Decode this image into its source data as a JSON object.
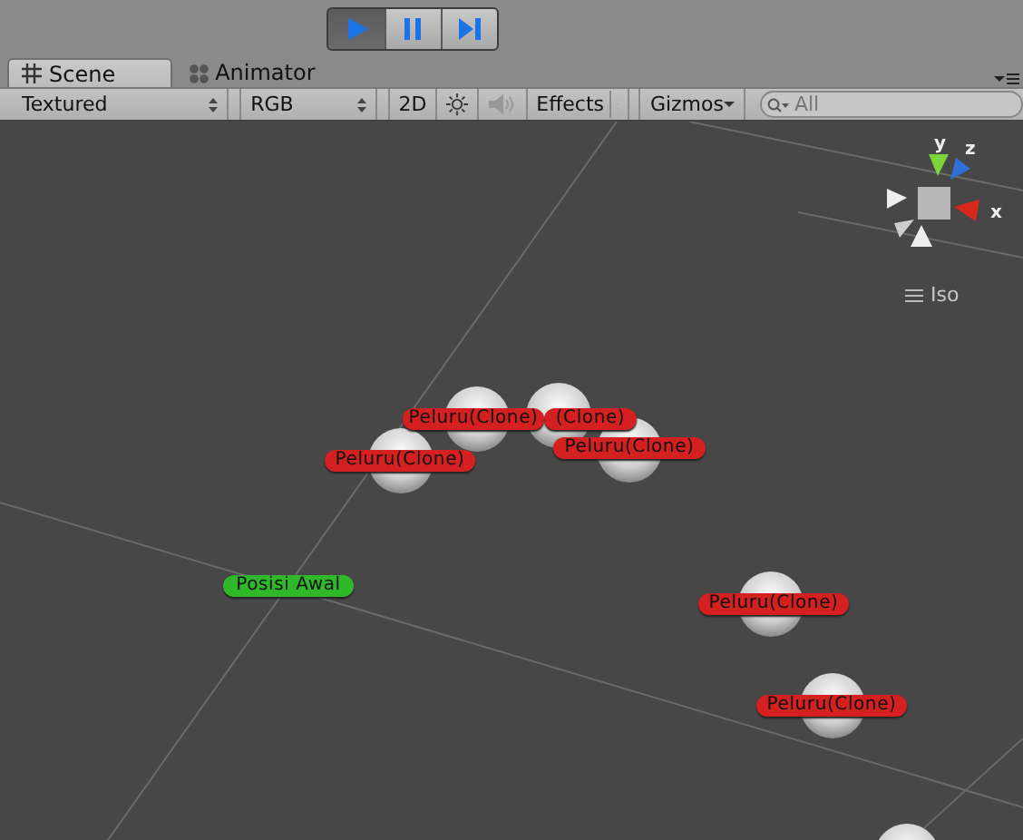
{
  "play_controls": [
    {
      "kind": "play",
      "selected": true
    },
    {
      "kind": "pause",
      "selected": false
    },
    {
      "kind": "step",
      "selected": false
    }
  ],
  "tabs": [
    {
      "label": "Scene",
      "kind": "scene",
      "selected": true
    },
    {
      "label": "Animator",
      "kind": "animator",
      "selected": false
    }
  ],
  "scene_toolbar": {
    "render_mode": "Textured",
    "color_mode": "RGB",
    "mode_2d": "2D",
    "audio": {
      "disabled": true
    },
    "effects": "Effects",
    "gizmos": "Gizmos",
    "search": {
      "placeholder": "All"
    }
  },
  "orientation_gizmo": {
    "axes": [
      "y",
      "z",
      "x"
    ],
    "projection": "Iso"
  },
  "labels": [
    {
      "text": "Peluru(Clone)",
      "color": "#d42020"
    },
    {
      "text": "(Clone)",
      "color": "#d42020"
    },
    {
      "text": "Peluru(Clone)",
      "color": "#d42020"
    },
    {
      "text": "Peluru(Clone)",
      "color": "#d42020"
    },
    {
      "text": "Posisi Awal",
      "color": "#2fb82a"
    },
    {
      "text": "Peluru(Clone)",
      "color": "#d42020"
    },
    {
      "text": "Peluru(Clone)",
      "color": "#d42020"
    }
  ]
}
